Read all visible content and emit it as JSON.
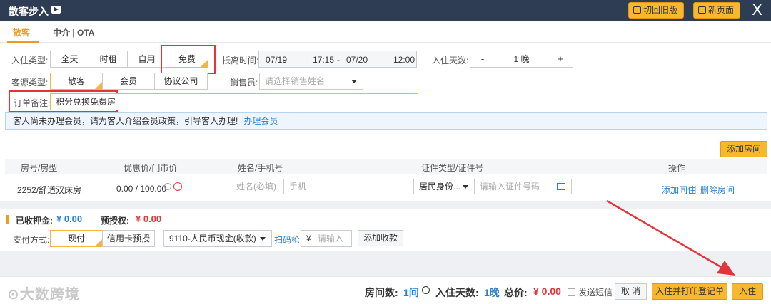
{
  "window": {
    "title": "散客步入",
    "btn_switch_old": "切回旧版",
    "btn_new_page": "新页面",
    "close": "X"
  },
  "tabs": [
    {
      "label": "散客"
    },
    {
      "label": "中介 | OTA"
    }
  ],
  "form": {
    "checkin_type": {
      "label": "入住类型:",
      "options": [
        "全天",
        "时租",
        "自用",
        "免费"
      ],
      "selected": "免费"
    },
    "arrive_depart": {
      "label": "抵离时间:",
      "start_date": "07/19",
      "start_time": "17:15",
      "dash": "-",
      "end_date": "07/20",
      "end_time": "12:00"
    },
    "nights": {
      "label": "入住天数:",
      "minus": "-",
      "value": "1 晚",
      "plus": "+"
    },
    "guest_source": {
      "label": "客源类型:",
      "options": [
        "散客",
        "会员",
        "协议公司"
      ],
      "selected": "散客"
    },
    "salesperson": {
      "label": "销售员:",
      "placeholder": "请选择销售姓名"
    },
    "order_remark": {
      "label": "订单备注:",
      "value": "积分兑换免费房"
    },
    "notice": {
      "text": "客人尚未办理会员，请为客人介绍会员政策，引导客人办理!",
      "link": "办理会员"
    }
  },
  "rooms": {
    "add_button": "添加房间",
    "headers": [
      "房号/房型",
      "优惠价/门市价",
      "姓名/手机号",
      "证件类型/证件号",
      "操作"
    ],
    "rows": [
      {
        "room": "2252/舒适双床房",
        "price": "0.00 / 100.00",
        "name_placeholder": "姓名(必填)",
        "phone_placeholder": "手机",
        "id_type": "居民身份...",
        "id_placeholder": "请输入证件号码",
        "action_add": "添加同住",
        "action_delete": "删除房间"
      }
    ]
  },
  "payment": {
    "deposit_label": "已收押金:",
    "deposit_value": "¥ 0.00",
    "preauth_label": "预授权:",
    "preauth_value": "¥ 0.00",
    "method_label": "支付方式:",
    "methods": [
      "现付",
      "信用卡预授"
    ],
    "method_selected": "现付",
    "account": "9110-人民币现金(收款)",
    "scan_link": "扫码枪",
    "amount_prefix": "¥",
    "amount_placeholder": "请输入",
    "add_button": "添加收款"
  },
  "footer": {
    "watermark": "大数跨境",
    "rooms_label": "房间数:",
    "rooms_value": "1间",
    "nights_label": "入住天数:",
    "nights_value": "1晚",
    "total_label": "总价:",
    "total_value": "¥ 0.00",
    "sms_label": "发送短信",
    "cancel": "取 消",
    "checkin_print": "入住并打印登记单",
    "checkin": "入住"
  },
  "colors": {
    "accent": "#f7b82e",
    "titlebar": "#2e3d54",
    "highlight_red": "#e5333b",
    "link": "#2b7fd3"
  }
}
